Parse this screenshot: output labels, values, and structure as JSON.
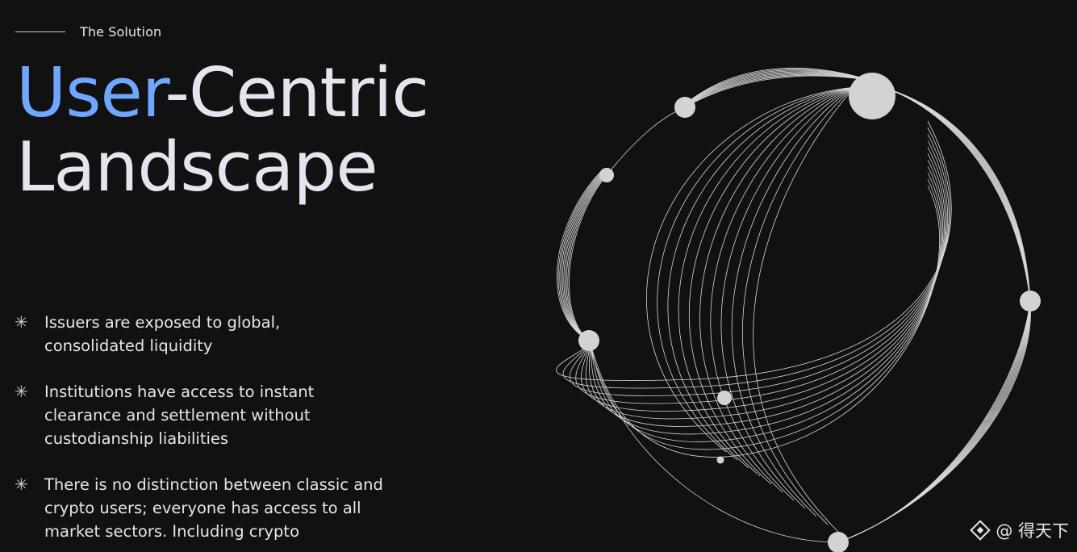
{
  "eyebrow": {
    "label": "The Solution"
  },
  "headline": {
    "accent": "User",
    "rest_line1": "-Centric",
    "line2": "Landscape"
  },
  "bullets": [
    {
      "icon": "asterisk-icon",
      "text_line1": "Issuers are exposed to global,",
      "text_line2": "consolidated liquidity"
    },
    {
      "icon": "asterisk-icon",
      "text_line1": "Institutions have access to instant",
      "text_line2": "clearance and settlement without",
      "text_line3": "custodianship liabilities"
    },
    {
      "icon": "asterisk-icon",
      "text_line1": "There is no distinction between classic and",
      "text_line2": "crypto users; everyone has access to all",
      "text_line3": "market sectors. Including crypto"
    }
  ],
  "watermark": {
    "logo": "diamond-logo-icon",
    "text": "@ 得天下"
  },
  "colors": {
    "background": "#111111",
    "text": "#e6e4ef",
    "accent": "#6fa7ff",
    "lines": "#d8d8d8",
    "nodes": "#d3d3d3"
  }
}
